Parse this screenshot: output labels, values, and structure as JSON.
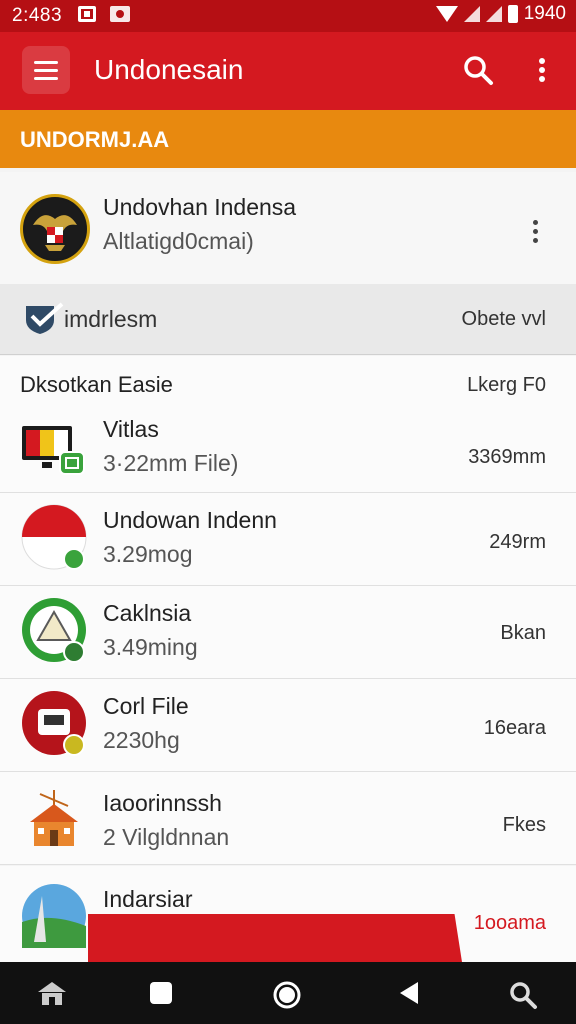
{
  "status_bar": {
    "time": "2:483",
    "battery_time": "1940"
  },
  "toolbar": {
    "title": "Undonesain",
    "icons": [
      "menu-icon",
      "search-icon",
      "more-vert-icon"
    ]
  },
  "banner": {
    "label": "UNDORMJ.AA"
  },
  "profile": {
    "name": "Undovhan Indensa",
    "subtitle": "Altlatigd0cmai)"
  },
  "section": {
    "label": "imdrlesm",
    "right": "Obete vvl"
  },
  "list_header": {
    "left": "Dksotkan Easie",
    "right": "Lkerg F0"
  },
  "items": [
    {
      "title": "Vitlas",
      "subtitle": "3·22mm File)",
      "right": "3369mm",
      "icon": "tv-icon"
    },
    {
      "title": "Undowan Indenn",
      "subtitle": "3.29mog",
      "right": "249rm",
      "icon": "flag-ball-icon"
    },
    {
      "title": "Caklnsia",
      "subtitle": "3.49ming",
      "right": "Bkan",
      "icon": "tent-icon"
    },
    {
      "title": "Corl File",
      "subtitle": "2230hg",
      "right": "16eara",
      "icon": "toolbox-icon"
    },
    {
      "title": "Iaoorinnssh",
      "subtitle": "2 Vilgldnnan",
      "right": "Fkes",
      "icon": "house-icon"
    },
    {
      "title": "Indarsiar",
      "subtitle": "",
      "right": "1ooama",
      "icon": "landscape-icon"
    }
  ],
  "colors": {
    "primary": "#d41920",
    "status": "#b50f14",
    "accent": "#e8890f"
  }
}
